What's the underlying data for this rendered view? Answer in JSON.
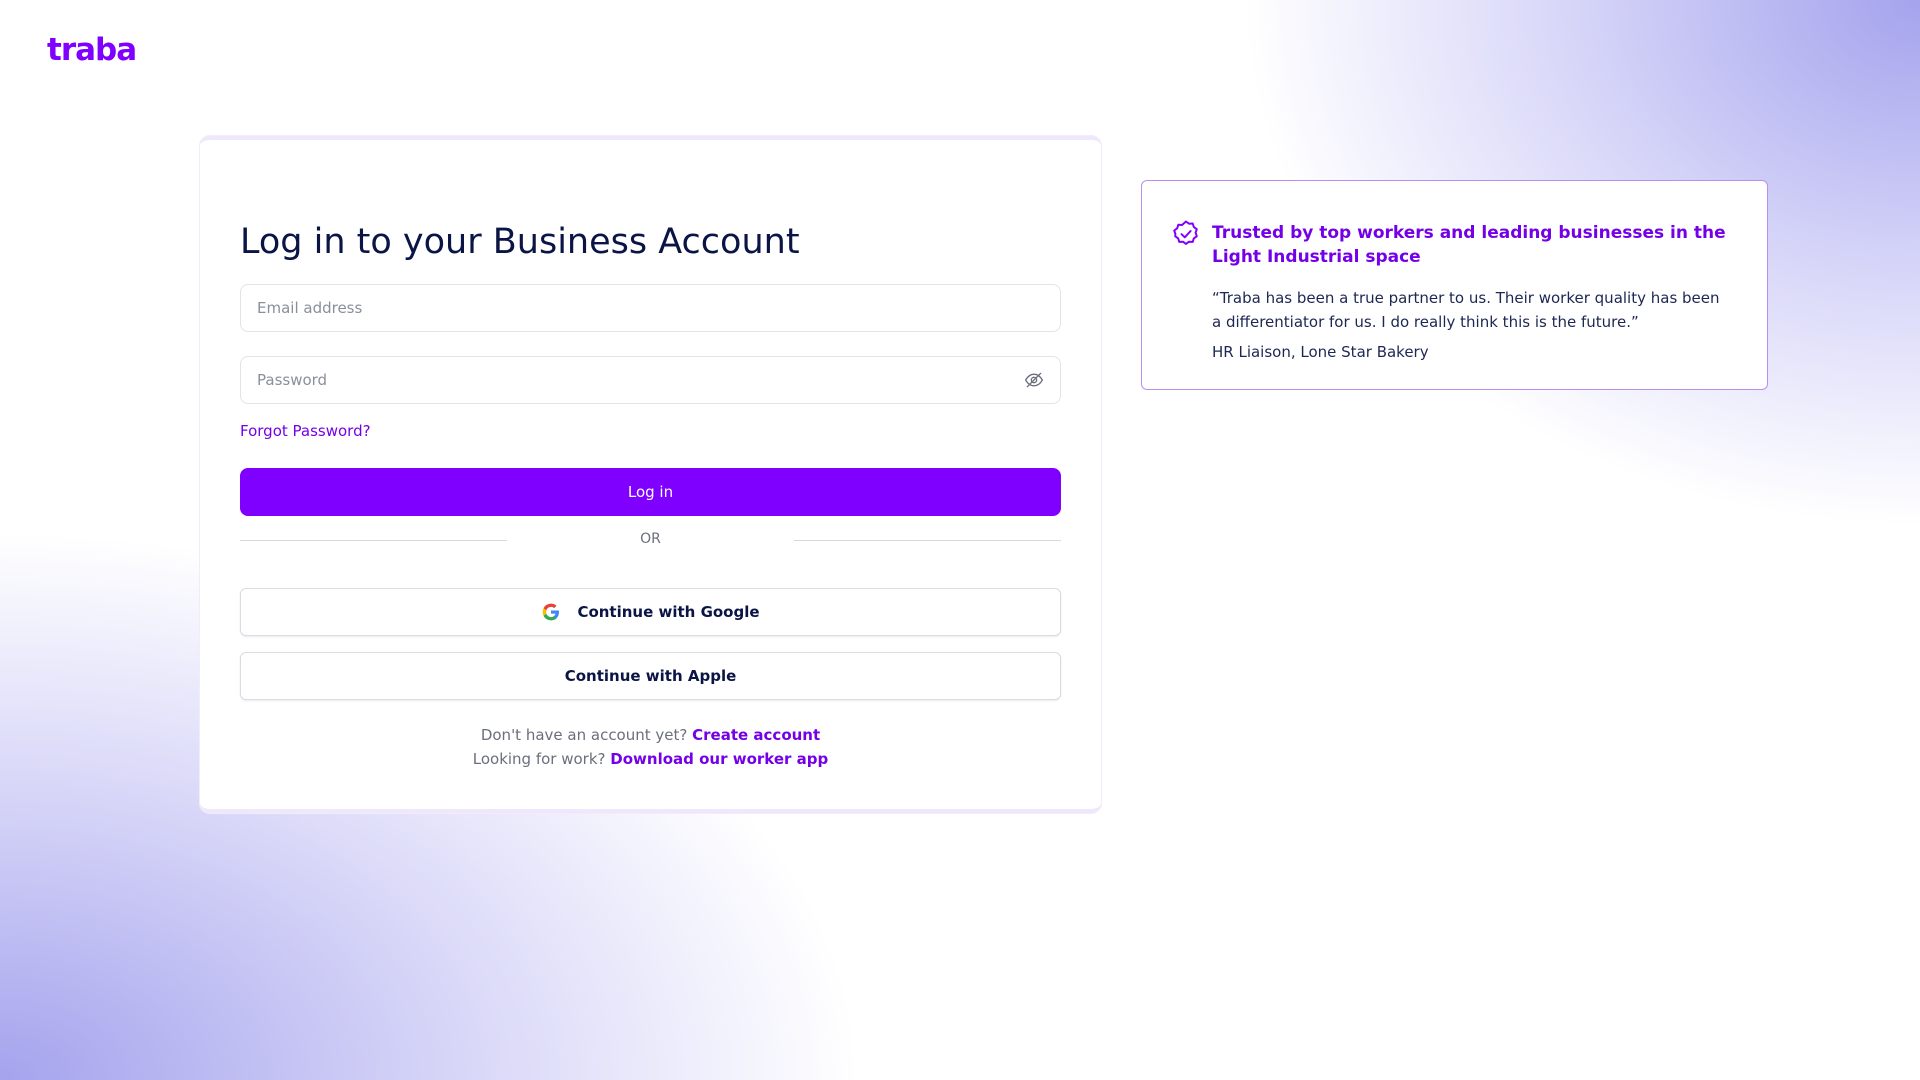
{
  "brand": {
    "logo_text": "traba",
    "accent": "#8000ff"
  },
  "login": {
    "title": "Log in to your Business Account",
    "email_placeholder": "Email address",
    "email_value": "",
    "password_placeholder": "Password",
    "password_value": "",
    "password_toggle_icon": "eye-off-icon",
    "forgot_label": "Forgot Password?",
    "submit_label": "Log in",
    "divider_label": "OR",
    "google_label": "Continue with Google",
    "google_icon": "google-icon",
    "apple_label": "Continue with Apple",
    "signup_prompt": "Don't have an account yet?",
    "signup_link": "Create account",
    "worker_prompt": "Looking for work?",
    "worker_link": "Download our worker app"
  },
  "testimonial": {
    "icon": "check-circle-icon",
    "heading": "Trusted by top workers and leading businesses in the Light Industrial space",
    "quote": "“Traba has been a true partner to us. Their worker quality has been a differentiator for us. I do really think this is the future.”",
    "author": "HR Liaison, Lone Star Bakery"
  }
}
